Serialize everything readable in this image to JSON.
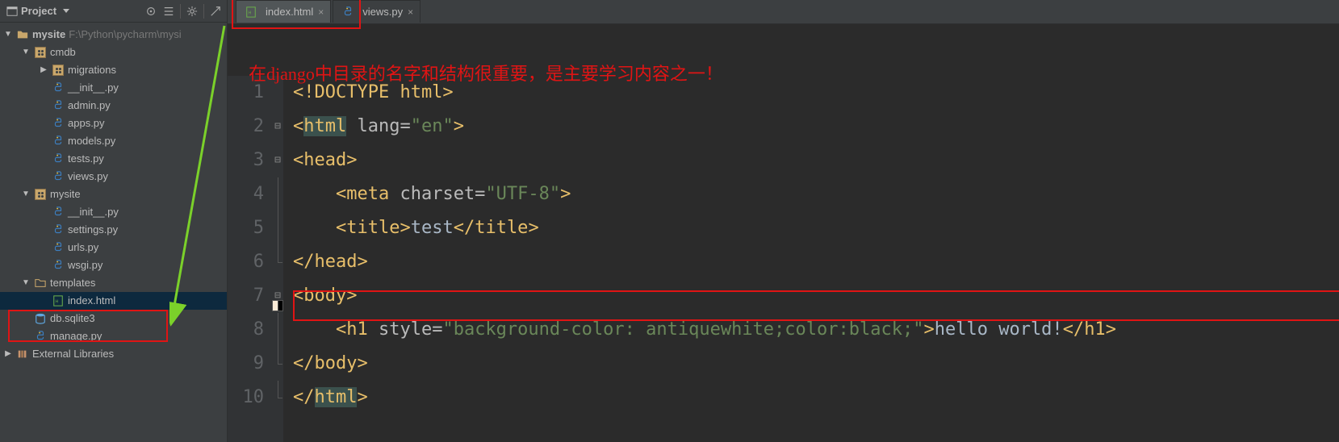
{
  "sidebar": {
    "title": "Project",
    "root": {
      "name": "mysite",
      "path": "F:\\Python\\pycharm\\mysi"
    },
    "apps_pkg": "cmdb",
    "migrations": "migrations",
    "files": {
      "init": "__init__.py",
      "admin": "admin.py",
      "apps": "apps.py",
      "models": "models.py",
      "tests": "tests.py",
      "views": "views.py"
    },
    "mysite_pkg": "mysite",
    "mysite_files": {
      "init": "__init__.py",
      "settings": "settings.py",
      "urls": "urls.py",
      "wsgi": "wsgi.py"
    },
    "templates_dir": "templates",
    "index_html": "index.html",
    "db": "db.sqlite3",
    "manage": "manage.py",
    "ext_lib": "External Libraries"
  },
  "tabs": {
    "active": "index.html",
    "inactive": "views.py"
  },
  "annotation": "在django中目录的名字和结构很重要，是主要学习内容之一！",
  "code": {
    "line_numbers": [
      "1",
      "2",
      "3",
      "4",
      "5",
      "6",
      "7",
      "8",
      "9",
      "10"
    ],
    "l1": "<!DOCTYPE html>",
    "l2_open": "<",
    "l2_tag": "html",
    "l2_attr": " lang=",
    "l2_val": "\"en\"",
    "l2_close": ">",
    "l3_open": "<",
    "l3_tag": "head",
    "l3_close": ">",
    "l4_open": "    <",
    "l4_tag": "meta",
    "l4_attr": " charset=",
    "l4_val": "\"UTF-8\"",
    "l4_close": ">",
    "l5a": "    <",
    "l5_tag": "title",
    "l5b": ">",
    "l5_txt": "test",
    "l5c": "</",
    "l5d": ">",
    "l6": "</",
    "l6_tag": "head",
    "l6b": ">",
    "l7": "<",
    "l7_tag": "body",
    "l7b": ">",
    "l8a": "    <",
    "l8_tag": "h1",
    "l8_attr": " style=",
    "l8_val": "\"background-color: antiquewhite;color:black;\"",
    "l8b": ">",
    "l8_txt": "hello world!",
    "l8c": "</",
    "l8d": ">",
    "l9": "</",
    "l9_tag": "body",
    "l9b": ">",
    "l10": "</",
    "l10_tag": "html",
    "l10b": ">"
  },
  "colors": {
    "swatch1": "#faebd7",
    "swatch2": "#000000"
  }
}
